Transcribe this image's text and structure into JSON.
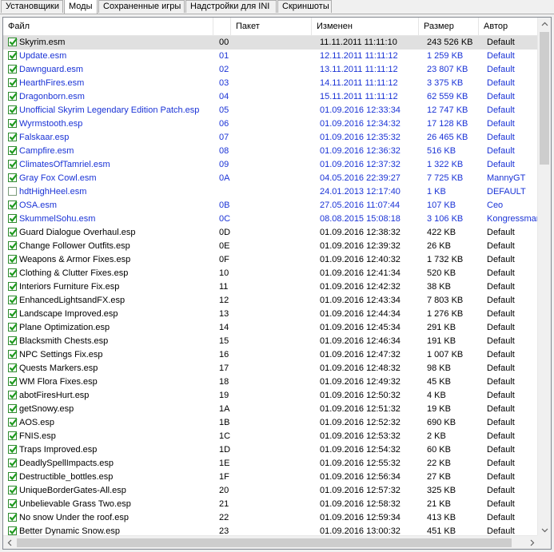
{
  "tabs": [
    {
      "label": "Установщики",
      "active": false
    },
    {
      "label": "Моды",
      "active": true
    },
    {
      "label": "Сохраненные игры",
      "active": false
    },
    {
      "label": "Надстройки для INI",
      "active": false
    },
    {
      "label": "Скриншоты",
      "active": false
    }
  ],
  "columns": {
    "file": "Файл",
    "order": "",
    "package": "Пакет",
    "modified": "Изменен",
    "size": "Размер",
    "author": "Автор"
  },
  "colors": {
    "blue_text": "#1a33d6",
    "checkbox_green": "#2f8a2f",
    "selected_row": "#e0e0e0"
  },
  "mods": [
    {
      "name": "Skyrim.esm",
      "order": "00",
      "modified": "11.11.2011 11:11:10",
      "size": "243 526 KB",
      "author": "Default",
      "checked": true,
      "blue": false,
      "selected": true
    },
    {
      "name": "Update.esm",
      "order": "01",
      "modified": "12.11.2011 11:11:12",
      "size": "1 259 KB",
      "author": "Default",
      "checked": true,
      "blue": true
    },
    {
      "name": "Dawnguard.esm",
      "order": "02",
      "modified": "13.11.2011 11:11:12",
      "size": "23 807 KB",
      "author": "Default",
      "checked": true,
      "blue": true
    },
    {
      "name": "HearthFires.esm",
      "order": "03",
      "modified": "14.11.2011 11:11:12",
      "size": "3 375 KB",
      "author": "Default",
      "checked": true,
      "blue": true
    },
    {
      "name": "Dragonborn.esm",
      "order": "04",
      "modified": "15.11.2011 11:11:12",
      "size": "62 559 KB",
      "author": "Default",
      "checked": true,
      "blue": true
    },
    {
      "name": "Unofficial Skyrim Legendary Edition Patch.esp",
      "order": "05",
      "modified": "01.09.2016 12:33:34",
      "size": "12 747 KB",
      "author": "Default",
      "checked": true,
      "blue": true
    },
    {
      "name": "Wyrmstooth.esp",
      "order": "06",
      "modified": "01.09.2016 12:34:32",
      "size": "17 128 KB",
      "author": "Default",
      "checked": true,
      "blue": true
    },
    {
      "name": "Falskaar.esp",
      "order": "07",
      "modified": "01.09.2016 12:35:32",
      "size": "26 465 KB",
      "author": "Default",
      "checked": true,
      "blue": true
    },
    {
      "name": "Campfire.esm",
      "order": "08",
      "modified": "01.09.2016 12:36:32",
      "size": "516 KB",
      "author": "Default",
      "checked": true,
      "blue": true
    },
    {
      "name": "ClimatesOfTamriel.esm",
      "order": "09",
      "modified": "01.09.2016 12:37:32",
      "size": "1 322 KB",
      "author": "Default",
      "checked": true,
      "blue": true
    },
    {
      "name": "Gray Fox Cowl.esm",
      "order": "0A",
      "modified": "04.05.2016 22:39:27",
      "size": "7 725 KB",
      "author": "MannyGT",
      "checked": true,
      "blue": true
    },
    {
      "name": "hdtHighHeel.esm",
      "order": "",
      "modified": "24.01.2013 12:17:40",
      "size": "1 KB",
      "author": "DEFAULT",
      "checked": false,
      "blue": true
    },
    {
      "name": "OSA.esm",
      "order": "0B",
      "modified": "27.05.2016 11:07:44",
      "size": "107 KB",
      "author": "Ceo",
      "checked": true,
      "blue": true
    },
    {
      "name": "SkummelSohu.esm",
      "order": "0C",
      "modified": "08.08.2015 15:08:18",
      "size": "3 106 KB",
      "author": "Kongressman",
      "checked": true,
      "blue": true
    },
    {
      "name": "Guard Dialogue Overhaul.esp",
      "order": "0D",
      "modified": "01.09.2016 12:38:32",
      "size": "422 KB",
      "author": "Default",
      "checked": true,
      "blue": false
    },
    {
      "name": "Change Follower Outfits.esp",
      "order": "0E",
      "modified": "01.09.2016 12:39:32",
      "size": "26 KB",
      "author": "Default",
      "checked": true,
      "blue": false
    },
    {
      "name": "Weapons & Armor Fixes.esp",
      "order": "0F",
      "modified": "01.09.2016 12:40:32",
      "size": "1 732 KB",
      "author": "Default",
      "checked": true,
      "blue": false
    },
    {
      "name": "Clothing & Clutter Fixes.esp",
      "order": "10",
      "modified": "01.09.2016 12:41:34",
      "size": "520 KB",
      "author": "Default",
      "checked": true,
      "blue": false
    },
    {
      "name": "Interiors Furniture Fix.esp",
      "order": "11",
      "modified": "01.09.2016 12:42:32",
      "size": "38 KB",
      "author": "Default",
      "checked": true,
      "blue": false
    },
    {
      "name": "EnhancedLightsandFX.esp",
      "order": "12",
      "modified": "01.09.2016 12:43:34",
      "size": "7 803 KB",
      "author": "Default",
      "checked": true,
      "blue": false
    },
    {
      "name": "Landscape Improved.esp",
      "order": "13",
      "modified": "01.09.2016 12:44:34",
      "size": "1 276 KB",
      "author": "Default",
      "checked": true,
      "blue": false
    },
    {
      "name": "Plane Optimization.esp",
      "order": "14",
      "modified": "01.09.2016 12:45:34",
      "size": "291 KB",
      "author": "Default",
      "checked": true,
      "blue": false
    },
    {
      "name": "Blacksmith Chests.esp",
      "order": "15",
      "modified": "01.09.2016 12:46:34",
      "size": "191 KB",
      "author": "Default",
      "checked": true,
      "blue": false
    },
    {
      "name": "NPC Settings Fix.esp",
      "order": "16",
      "modified": "01.09.2016 12:47:32",
      "size": "1 007 KB",
      "author": "Default",
      "checked": true,
      "blue": false
    },
    {
      "name": "Quests Markers.esp",
      "order": "17",
      "modified": "01.09.2016 12:48:32",
      "size": "98 KB",
      "author": "Default",
      "checked": true,
      "blue": false
    },
    {
      "name": "WM Flora Fixes.esp",
      "order": "18",
      "modified": "01.09.2016 12:49:32",
      "size": "45 KB",
      "author": "Default",
      "checked": true,
      "blue": false
    },
    {
      "name": "abotFiresHurt.esp",
      "order": "19",
      "modified": "01.09.2016 12:50:32",
      "size": "4 KB",
      "author": "Default",
      "checked": true,
      "blue": false
    },
    {
      "name": "getSnowy.esp",
      "order": "1A",
      "modified": "01.09.2016 12:51:32",
      "size": "19 KB",
      "author": "Default",
      "checked": true,
      "blue": false
    },
    {
      "name": "AOS.esp",
      "order": "1B",
      "modified": "01.09.2016 12:52:32",
      "size": "690 KB",
      "author": "Default",
      "checked": true,
      "blue": false
    },
    {
      "name": "FNIS.esp",
      "order": "1C",
      "modified": "01.09.2016 12:53:32",
      "size": "2 KB",
      "author": "Default",
      "checked": true,
      "blue": false
    },
    {
      "name": "Traps Improved.esp",
      "order": "1D",
      "modified": "01.09.2016 12:54:32",
      "size": "60 KB",
      "author": "Default",
      "checked": true,
      "blue": false
    },
    {
      "name": "DeadlySpellImpacts.esp",
      "order": "1E",
      "modified": "01.09.2016 12:55:32",
      "size": "22 KB",
      "author": "Default",
      "checked": true,
      "blue": false
    },
    {
      "name": "Destructible_bottles.esp",
      "order": "1F",
      "modified": "01.09.2016 12:56:34",
      "size": "27 KB",
      "author": "Default",
      "checked": true,
      "blue": false
    },
    {
      "name": "UniqueBorderGates-All.esp",
      "order": "20",
      "modified": "01.09.2016 12:57:32",
      "size": "325 KB",
      "author": "Default",
      "checked": true,
      "blue": false
    },
    {
      "name": "Unbelievable Grass Two.esp",
      "order": "21",
      "modified": "01.09.2016 12:58:32",
      "size": "21 KB",
      "author": "Default",
      "checked": true,
      "blue": false
    },
    {
      "name": "No snow Under the roof.esp",
      "order": "22",
      "modified": "01.09.2016 12:59:34",
      "size": "413 KB",
      "author": "Default",
      "checked": true,
      "blue": false
    },
    {
      "name": "Better Dynamic Snow.esp",
      "order": "23",
      "modified": "01.09.2016 13:00:32",
      "size": "451 KB",
      "author": "Default",
      "checked": true,
      "blue": false
    }
  ]
}
